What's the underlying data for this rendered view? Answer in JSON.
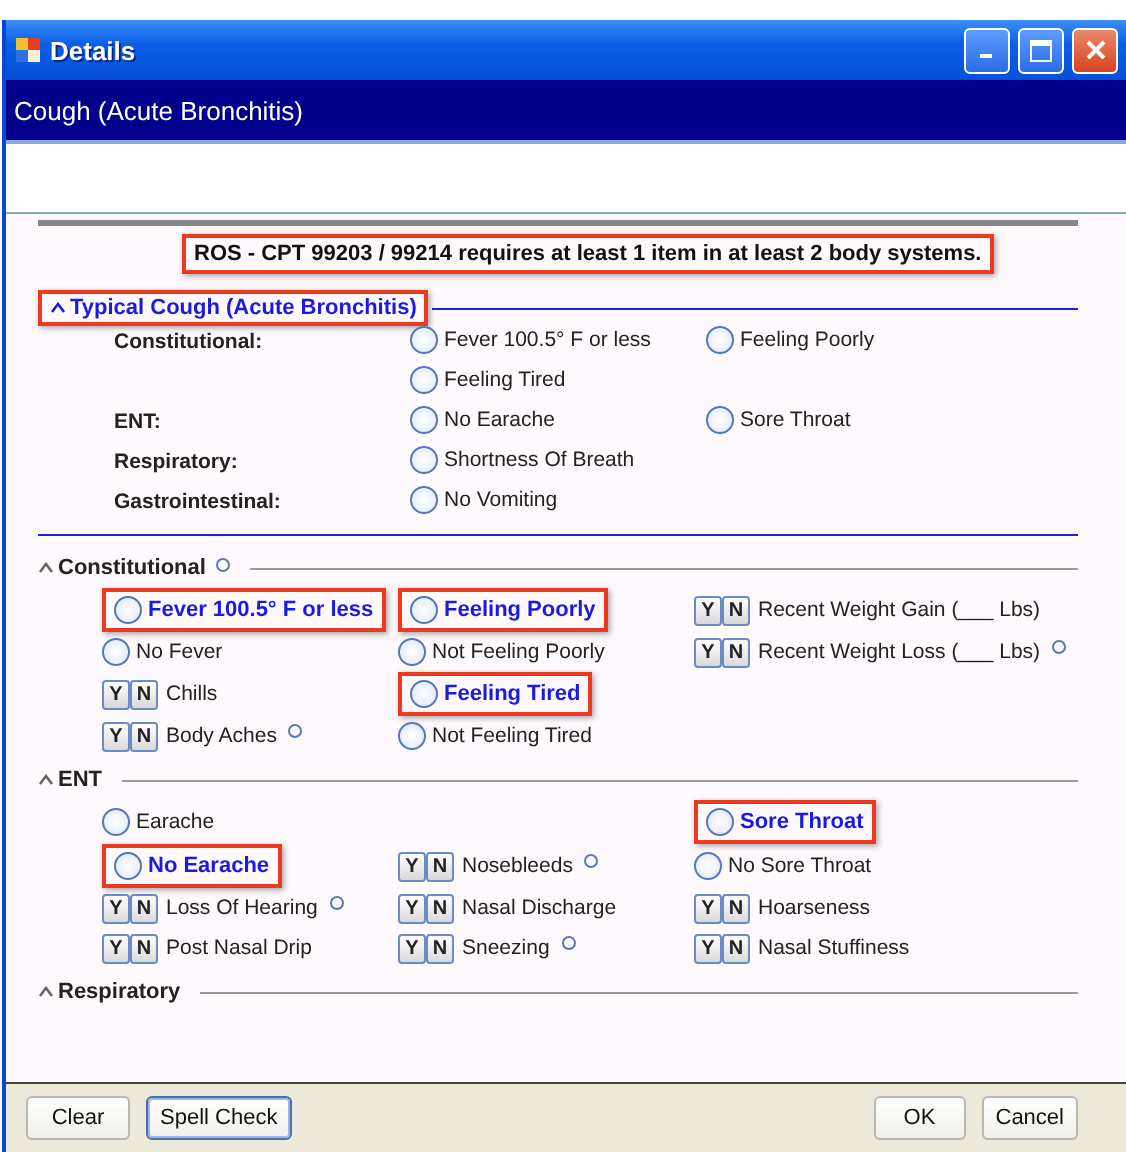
{
  "window": {
    "title": "Details"
  },
  "subtitle": "Cough (Acute Bronchitis)",
  "notice": {
    "text": "ROS - CPT 99203 / 99214 requires at least 1 item in at least 2 body systems.",
    "highlighted": true
  },
  "typical": {
    "title": "Typical Cough (Acute Bronchitis)",
    "highlighted": true,
    "rows": [
      {
        "label": "Constitutional:",
        "cells": [
          {
            "kind": "radio",
            "text": "Fever 100.5° F or less"
          },
          {
            "kind": "radio",
            "text": "Feeling Poorly"
          }
        ]
      },
      {
        "cells": [
          {
            "kind": "radio",
            "text": "Feeling Tired"
          },
          null
        ]
      },
      {
        "label": "ENT:",
        "cells": [
          {
            "kind": "radio",
            "text": "No Earache"
          },
          {
            "kind": "radio",
            "text": "Sore Throat"
          }
        ]
      },
      {
        "label": "Respiratory:",
        "cells": [
          {
            "kind": "radio",
            "text": "Shortness Of Breath"
          },
          null
        ]
      },
      {
        "label": "Gastrointestinal:",
        "cells": [
          {
            "kind": "radio",
            "text": "No Vomiting"
          },
          null
        ]
      }
    ]
  },
  "sections": [
    {
      "title": "Constitutional",
      "note": true,
      "rows": [
        [
          {
            "kind": "radio",
            "text": "Fever 100.5° F or less",
            "highlighted": true
          },
          {
            "kind": "radio",
            "text": "Feeling Poorly",
            "highlighted": true
          },
          {
            "kind": "yn",
            "yes": "Y",
            "no": "N",
            "text": "Recent Weight Gain (___ Lbs)"
          }
        ],
        [
          {
            "kind": "radio",
            "text": "No Fever"
          },
          {
            "kind": "radio",
            "text": "Not Feeling Poorly"
          },
          {
            "kind": "yn",
            "yes": "Y",
            "no": "N",
            "text": "Recent Weight Loss (___ Lbs)",
            "note": true
          }
        ],
        [
          {
            "kind": "yn",
            "yes": "Y",
            "no": "N",
            "text": "Chills"
          },
          {
            "kind": "radio",
            "text": "Feeling Tired",
            "highlighted": true
          },
          null
        ],
        [
          {
            "kind": "yn",
            "yes": "Y",
            "no": "N",
            "text": "Body Aches",
            "note": true
          },
          {
            "kind": "radio",
            "text": "Not Feeling Tired"
          },
          null
        ]
      ]
    },
    {
      "title": "ENT",
      "rows": [
        [
          {
            "kind": "radio",
            "text": "Earache"
          },
          null,
          {
            "kind": "radio",
            "text": "Sore Throat",
            "highlighted": true
          }
        ],
        [
          {
            "kind": "radio",
            "text": "No Earache",
            "highlighted": true
          },
          {
            "kind": "yn",
            "yes": "Y",
            "no": "N",
            "text": "Nosebleeds",
            "note": true
          },
          {
            "kind": "radio",
            "text": "No Sore Throat"
          }
        ],
        [
          {
            "kind": "yn",
            "yes": "Y",
            "no": "N",
            "text": "Loss Of Hearing",
            "note": true
          },
          {
            "kind": "yn",
            "yes": "Y",
            "no": "N",
            "text": "Nasal Discharge"
          },
          {
            "kind": "yn",
            "yes": "Y",
            "no": "N",
            "text": "Hoarseness"
          }
        ],
        [
          {
            "kind": "yn",
            "yes": "Y",
            "no": "N",
            "text": "Post Nasal Drip"
          },
          {
            "kind": "yn",
            "yes": "Y",
            "no": "N",
            "text": "Sneezing",
            "note": true
          },
          {
            "kind": "yn",
            "yes": "Y",
            "no": "N",
            "text": "Nasal Stuffiness"
          }
        ]
      ]
    },
    {
      "title": "Respiratory"
    }
  ],
  "buttons": [
    {
      "label": "Clear",
      "focused": false
    },
    {
      "label": "Spell Check",
      "focused": true
    }
  ],
  "right_buttons": [
    {
      "label": "OK",
      "focused": false
    },
    {
      "label": "Cancel",
      "focused": false
    }
  ]
}
